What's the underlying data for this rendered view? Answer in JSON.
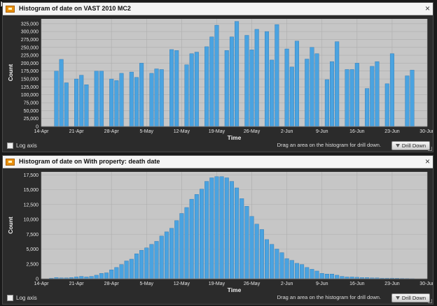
{
  "panels": [
    {
      "title": "Histogram of date on VAST 2010 MC2",
      "close_label": "×",
      "log_axis_label": "Log axis",
      "hint": "Drag an area on the histogram for drill down.",
      "drill_label": "Drill Down"
    },
    {
      "title": "Histogram of date on With property: death date",
      "close_label": "×",
      "log_axis_label": "Log axis",
      "hint": "Drag an area on the histogram for drill down.",
      "drill_label": "Drill Down"
    }
  ],
  "colors": {
    "bar": "#4aa3e0",
    "bar_edge": "#2a73b0",
    "plot_bg": "#c6c6c6",
    "grid": "#adadad",
    "panel_bg": "#2b2b2b",
    "icon": "#e8900e"
  },
  "chart_data": [
    {
      "type": "bar",
      "xlabel": "Time",
      "ylabel": "Count",
      "ylim": [
        0,
        340000
      ],
      "yticks": [
        0,
        25000,
        50000,
        75000,
        100000,
        125000,
        150000,
        175000,
        200000,
        225000,
        250000,
        275000,
        300000,
        325000
      ],
      "ytick_labels": [
        "0",
        "25,000",
        "50,000",
        "75,000",
        "100,000",
        "125,000",
        "150,000",
        "175,000",
        "200,000",
        "225,000",
        "250,000",
        "275,000",
        "300,000",
        "325,000"
      ],
      "x_start": "2010-04-14",
      "x_end": "2010-06-30",
      "xtick_labels": [
        "14-Apr",
        "21-Apr",
        "28-Apr",
        "5-May",
        "12-May",
        "19-May",
        "26-May",
        "2-Jun",
        "9-Jun",
        "16-Jun",
        "23-Jun",
        "30-Jun"
      ],
      "grid": true,
      "x": [
        "2010-04-17",
        "2010-04-18",
        "2010-04-19",
        "2010-04-20",
        "2010-04-21",
        "2010-04-22",
        "2010-04-23",
        "2010-04-24",
        "2010-04-25",
        "2010-04-26",
        "2010-04-27",
        "2010-04-28",
        "2010-04-29",
        "2010-04-30",
        "2010-05-01",
        "2010-05-02",
        "2010-05-03",
        "2010-05-04",
        "2010-05-05",
        "2010-05-06",
        "2010-05-07",
        "2010-05-08",
        "2010-05-09",
        "2010-05-10",
        "2010-05-11",
        "2010-05-12",
        "2010-05-13",
        "2010-05-14",
        "2010-05-15",
        "2010-05-16",
        "2010-05-17",
        "2010-05-18",
        "2010-05-19",
        "2010-05-20",
        "2010-05-21",
        "2010-05-22",
        "2010-05-23",
        "2010-05-24",
        "2010-05-25",
        "2010-05-26",
        "2010-05-27",
        "2010-05-28",
        "2010-05-29",
        "2010-05-30",
        "2010-05-31",
        "2010-06-01",
        "2010-06-02",
        "2010-06-03",
        "2010-06-04",
        "2010-06-05",
        "2010-06-06",
        "2010-06-07",
        "2010-06-08",
        "2010-06-09",
        "2010-06-10",
        "2010-06-11",
        "2010-06-12",
        "2010-06-13",
        "2010-06-14",
        "2010-06-15",
        "2010-06-16",
        "2010-06-17",
        "2010-06-18",
        "2010-06-19",
        "2010-06-20",
        "2010-06-21",
        "2010-06-22",
        "2010-06-23",
        "2010-06-24",
        "2010-06-25",
        "2010-06-26",
        "2010-06-27",
        "2010-06-28"
      ],
      "values": [
        175000,
        212000,
        138000,
        0,
        150000,
        162000,
        132000,
        0,
        175000,
        175000,
        0,
        150000,
        145000,
        168000,
        0,
        172000,
        155000,
        200000,
        0,
        168000,
        182000,
        180000,
        0,
        243000,
        240000,
        0,
        195000,
        230000,
        235000,
        0,
        252000,
        283000,
        320000,
        0,
        240000,
        283000,
        332000,
        0,
        288000,
        242000,
        307000,
        0,
        300000,
        210000,
        322000,
        0,
        245000,
        188000,
        270000,
        0,
        213000,
        250000,
        230000,
        0,
        148000,
        205000,
        268000,
        0,
        180000,
        180000,
        200000,
        0,
        120000,
        190000,
        205000,
        0,
        135000,
        230000,
        0,
        0,
        160000,
        178000,
        0
      ]
    },
    {
      "type": "bar",
      "xlabel": "Time",
      "ylabel": "Count",
      "ylim": [
        0,
        18000
      ],
      "yticks": [
        0,
        2500,
        5000,
        7500,
        10000,
        12500,
        15000,
        17500
      ],
      "ytick_labels": [
        "0",
        "2,500",
        "5,000",
        "7,500",
        "10,000",
        "12,500",
        "15,000",
        "17,500"
      ],
      "x_start": "2010-04-14",
      "x_end": "2010-06-30",
      "xtick_labels": [
        "14-Apr",
        "21-Apr",
        "28-Apr",
        "5-May",
        "12-May",
        "19-May",
        "26-May",
        "2-Jun",
        "9-Jun",
        "16-Jun",
        "23-Jun",
        "30-Jun"
      ],
      "grid": true,
      "x": [
        "2010-04-16",
        "2010-04-17",
        "2010-04-18",
        "2010-04-19",
        "2010-04-20",
        "2010-04-21",
        "2010-04-22",
        "2010-04-23",
        "2010-04-24",
        "2010-04-25",
        "2010-04-26",
        "2010-04-27",
        "2010-04-28",
        "2010-04-29",
        "2010-04-30",
        "2010-05-01",
        "2010-05-02",
        "2010-05-03",
        "2010-05-04",
        "2010-05-05",
        "2010-05-06",
        "2010-05-07",
        "2010-05-08",
        "2010-05-09",
        "2010-05-10",
        "2010-05-11",
        "2010-05-12",
        "2010-05-13",
        "2010-05-14",
        "2010-05-15",
        "2010-05-16",
        "2010-05-17",
        "2010-05-18",
        "2010-05-19",
        "2010-05-20",
        "2010-05-21",
        "2010-05-22",
        "2010-05-23",
        "2010-05-24",
        "2010-05-25",
        "2010-05-26",
        "2010-05-27",
        "2010-05-28",
        "2010-05-29",
        "2010-05-30",
        "2010-05-31",
        "2010-06-01",
        "2010-06-02",
        "2010-06-03",
        "2010-06-04",
        "2010-06-05",
        "2010-06-06",
        "2010-06-07",
        "2010-06-08",
        "2010-06-09",
        "2010-06-10",
        "2010-06-11",
        "2010-06-12",
        "2010-06-13",
        "2010-06-14",
        "2010-06-15",
        "2010-06-16",
        "2010-06-17",
        "2010-06-18",
        "2010-06-19",
        "2010-06-20",
        "2010-06-21",
        "2010-06-22",
        "2010-06-23",
        "2010-06-24",
        "2010-06-25",
        "2010-06-26",
        "2010-06-27"
      ],
      "values": [
        100,
        200,
        150,
        150,
        200,
        300,
        400,
        300,
        400,
        600,
        900,
        1000,
        1500,
        1900,
        2400,
        3000,
        3300,
        4200,
        4800,
        5200,
        5800,
        6300,
        7200,
        7900,
        8500,
        9800,
        11000,
        12000,
        13400,
        14200,
        15100,
        16400,
        17000,
        17200,
        17200,
        17000,
        16400,
        15300,
        13500,
        12200,
        10500,
        9200,
        8300,
        6600,
        5800,
        5000,
        4400,
        3400,
        3100,
        2600,
        2400,
        1900,
        1600,
        1300,
        900,
        800,
        800,
        600,
        400,
        300,
        300,
        250,
        200,
        200,
        150,
        150,
        100,
        100,
        100,
        80,
        60,
        50,
        30
      ]
    }
  ]
}
